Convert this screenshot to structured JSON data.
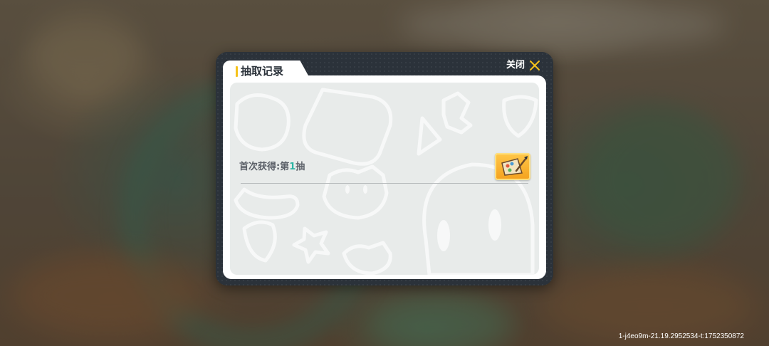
{
  "dialog": {
    "title": "抽取记录",
    "close_label": "关闭"
  },
  "records": [
    {
      "prefix": "首次获得:第",
      "count": "1",
      "suffix": "抽",
      "item_icon": "painting-palette-icon"
    }
  ],
  "watermark": "1-j4eo9m-21.19.2952534-t:1752350872",
  "colors": {
    "frame": "#2b323a",
    "accent_yellow": "#f5c21b",
    "count_teal": "#2bb3a3",
    "item_orange": "#f4a11d"
  }
}
